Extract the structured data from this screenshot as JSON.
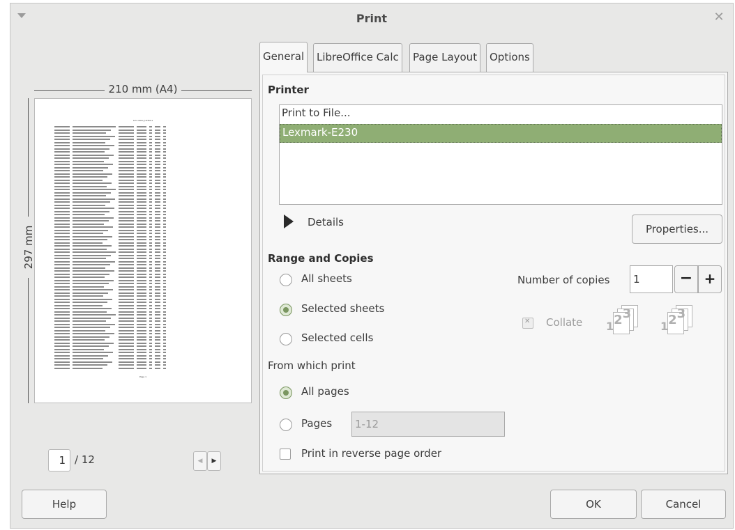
{
  "window": {
    "title": "Print"
  },
  "preview": {
    "width_label": "210 mm (A4)",
    "height_label": "297 mm",
    "doc_title": "Lulu-sales_LO3bk.s",
    "footer": "Page 1",
    "current_page": "1",
    "total_pages": "/ 12"
  },
  "tabs": [
    {
      "label": "General",
      "active": true
    },
    {
      "label": "LibreOffice Calc"
    },
    {
      "label": "Page Layout"
    },
    {
      "label": "Options"
    }
  ],
  "printer": {
    "section_title": "Printer",
    "items": [
      "Print to File...",
      "Lexmark-E230"
    ],
    "selected": "Lexmark-E230",
    "details_label": "Details",
    "properties_button": "Properties..."
  },
  "range": {
    "section_title": "Range and Copies",
    "options": [
      "All sheets",
      "Selected sheets",
      "Selected cells"
    ],
    "selected": "Selected sheets",
    "from_which_label": "From which print",
    "page_options": [
      "All pages",
      "Pages"
    ],
    "page_selected": "All pages",
    "pages_value": "1-12",
    "reverse_label": "Print in reverse page order"
  },
  "copies": {
    "label": "Number of copies",
    "value": "1",
    "minus": "−",
    "plus": "+",
    "collate_label": "Collate",
    "collate_digits": [
      "1",
      "2",
      "3"
    ]
  },
  "buttons": {
    "help": "Help",
    "ok": "OK",
    "cancel": "Cancel"
  }
}
